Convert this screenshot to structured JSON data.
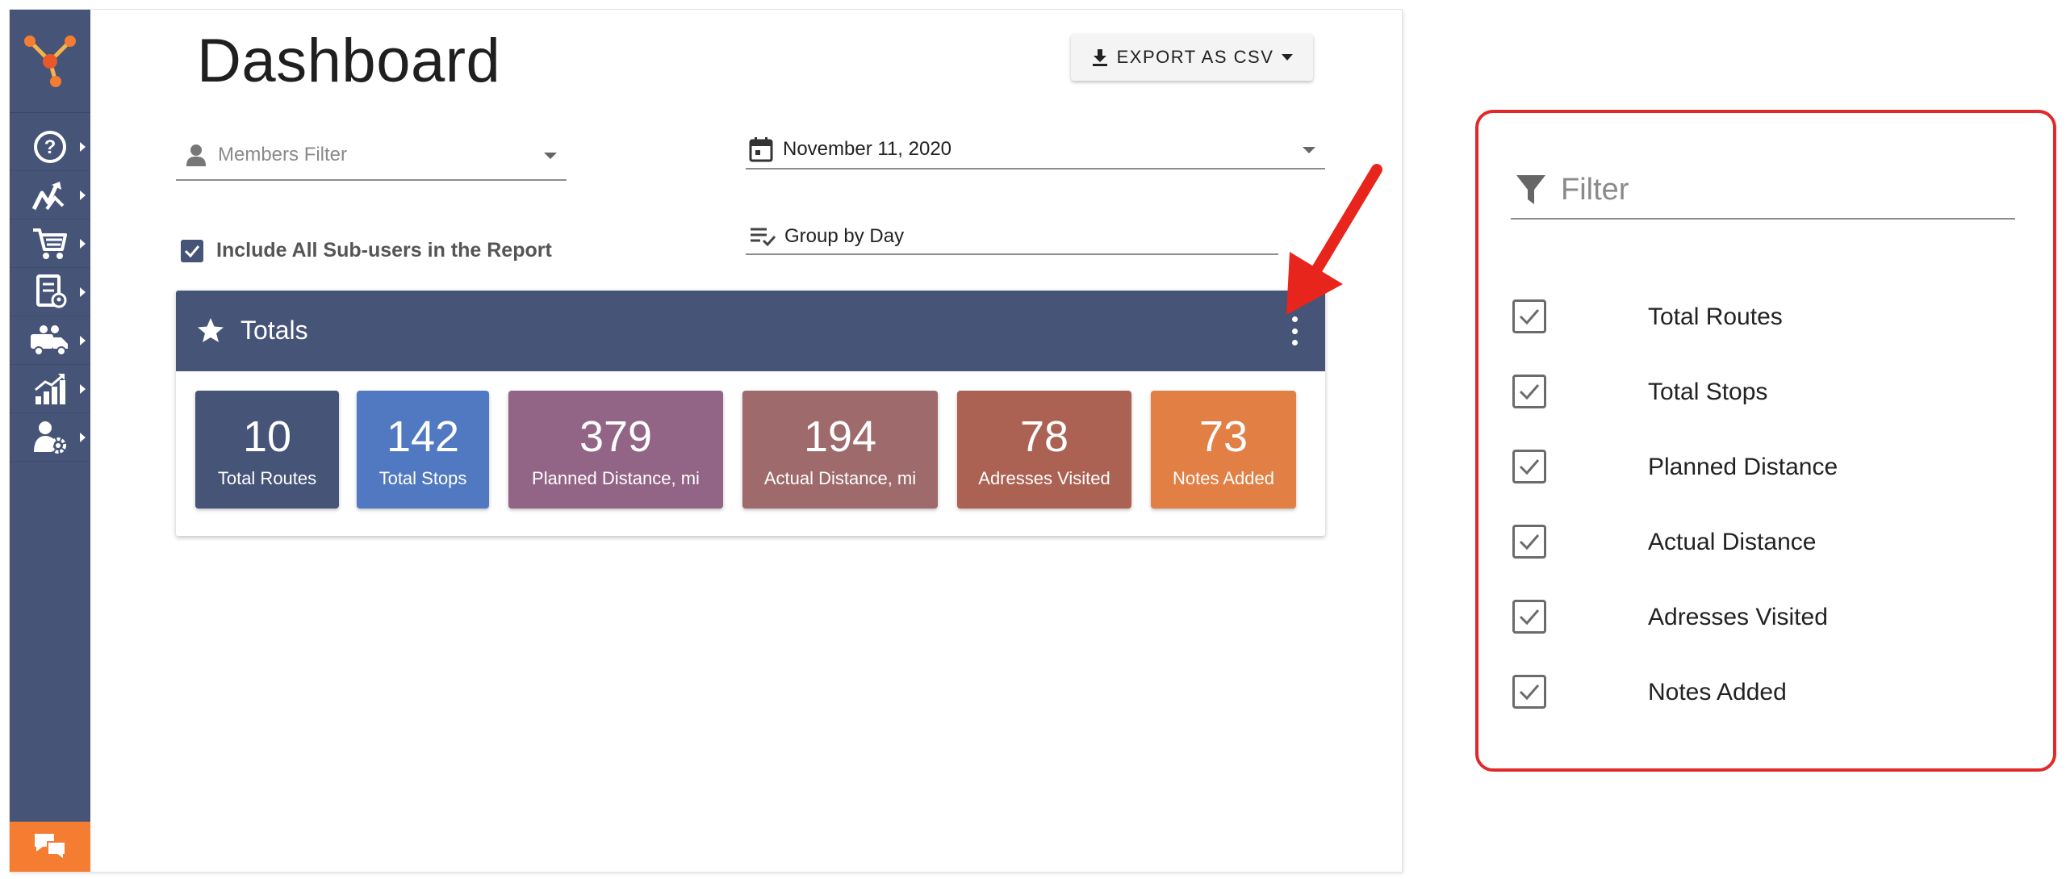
{
  "page": {
    "title": "Dashboard"
  },
  "toolbar": {
    "export_label": "EXPORT AS CSV"
  },
  "filters": {
    "members_placeholder": "Members Filter",
    "date_value": "November 11, 2020",
    "group_value": "Group by Day",
    "include_subusers_label": "Include All Sub-users in the Report",
    "include_subusers_checked": true
  },
  "sidebar": {
    "items": [
      {
        "icon": "help-icon"
      },
      {
        "icon": "routes-icon"
      },
      {
        "icon": "cart-icon"
      },
      {
        "icon": "address-book-icon"
      },
      {
        "icon": "fleet-icon"
      },
      {
        "icon": "analytics-icon"
      },
      {
        "icon": "user-settings-icon"
      }
    ],
    "chat_icon": "chat-icon"
  },
  "totals": {
    "title": "Totals",
    "tiles": [
      {
        "value": "10",
        "label": "Total Routes",
        "color": "#465478"
      },
      {
        "value": "142",
        "label": "Total Stops",
        "color": "#5079c2"
      },
      {
        "value": "379",
        "label": "Planned Distance, mi",
        "color": "#926486"
      },
      {
        "value": "194",
        "label": "Actual Distance, mi",
        "color": "#9e6a6c"
      },
      {
        "value": "78",
        "label": "Adresses Visited",
        "color": "#ac6253"
      },
      {
        "value": "73",
        "label": "Notes Added",
        "color": "#e27f44"
      }
    ]
  },
  "filter_panel": {
    "placeholder": "Filter",
    "options": [
      {
        "label": "Total Routes",
        "checked": true
      },
      {
        "label": "Total Stops",
        "checked": true
      },
      {
        "label": "Planned Distance",
        "checked": true
      },
      {
        "label": "Actual Distance",
        "checked": true
      },
      {
        "label": "Adresses Visited",
        "checked": true
      },
      {
        "label": "Notes Added",
        "checked": true
      }
    ]
  },
  "colors": {
    "sidebar": "#465478",
    "accent_orange": "#f47d31",
    "highlight_red": "#e02a2a"
  }
}
